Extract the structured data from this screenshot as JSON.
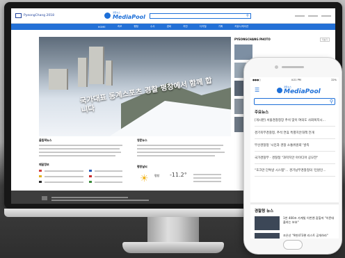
{
  "site": {
    "pc_logo": "PyeongChang 2018",
    "media_logo_sub": "경찰뉴스",
    "media_logo": "MediaPool",
    "nav": [
      "HOME",
      "속보",
      "행정",
      "수사",
      "경비",
      "치안",
      "디지털",
      "기획",
      "커뮤니케이션"
    ]
  },
  "hero": {
    "caption": "국가대표 동계스포츠 경찰 평창에서 함께 합니다"
  },
  "photo": {
    "title": "PYEONGCHANG PHOTO",
    "more": "더보기"
  },
  "sections": {
    "left_title": "올림픽뉴스",
    "mid_title": "영문뉴스",
    "medal_title": "메달정보",
    "weather_title": "평창날씨"
  },
  "weather": {
    "city": "평창",
    "temp": "-11.2°"
  },
  "phone": {
    "status_time": "4:21 PM",
    "status_battery": "22%",
    "logo_sub": "경찰뉴스",
    "logo": "MediaPool",
    "main_news_title": "주요뉴스",
    "news": [
      "[게시판] 서울경찰청장 추석 맞이 여의도 사회복지시...",
      "경기북부경찰청, 추석 연휴 특별치안대책 전개",
      "부산경찰청 '시민과 경찰 소통위원회' 발족",
      "국가경찰부 · 경찰청 \"과학치안 아이디어 공모전\"",
      "\"호크만 단톡방 시스템\"... 경기남부경찰청의 '민원인..."
    ],
    "police_news_title": "경찰청 뉴스",
    "police_news": [
      "1천 400조 가계빚 이번엔 잡힐까 \"이른대출하는 보호\"",
      "조은산 \"9천473편 리스트 공개하라\""
    ]
  },
  "colors": {
    "accent": "#1d6fd8",
    "nav_bar": "#2370d6",
    "bezel": "#171717",
    "footer": "#3d3d3d"
  }
}
